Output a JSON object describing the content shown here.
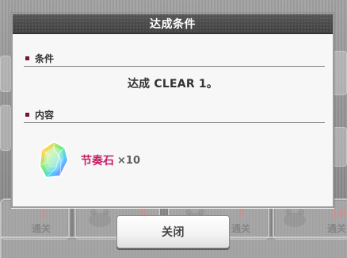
{
  "dialog": {
    "title": "达成条件",
    "condition_header": "条件",
    "condition_text": "达成 CLEAR 1。",
    "reward_header": "内容",
    "reward": {
      "name": "节奏石",
      "quantity": "×10",
      "icon": "rainbow-gem-icon"
    },
    "close_label": "关闭"
  },
  "background": {
    "numbers": [
      "1",
      "5",
      "7",
      "10"
    ],
    "labels": [
      "通关",
      "通关",
      "通关"
    ]
  },
  "colors": {
    "accent": "#c61d63",
    "title_bar": "#4a4a4a",
    "section_marker": "#7a1230"
  }
}
